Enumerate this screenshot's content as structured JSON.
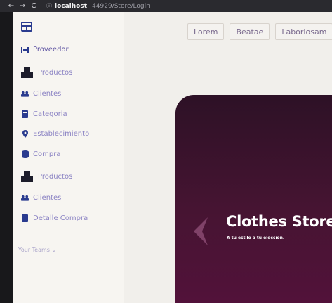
{
  "browser": {
    "nav": {
      "back": "←",
      "forward": "→",
      "reload": "C"
    },
    "url": {
      "host": "localhost",
      "path": ":44929/Store/Login"
    }
  },
  "sidebar": {
    "items": [
      {
        "label": "Proveedor",
        "icon": "people-carry-icon"
      },
      {
        "label": "Productos",
        "icon": "boxes-icon"
      },
      {
        "label": "Clientes",
        "icon": "users-icon"
      },
      {
        "label": "Categoria",
        "icon": "file-list-icon"
      },
      {
        "label": "Establecimiento",
        "icon": "map-pin-icon"
      },
      {
        "label": "Compra",
        "icon": "database-icon"
      },
      {
        "label": "Productos",
        "icon": "boxes-icon"
      },
      {
        "label": "Clientes",
        "icon": "users-icon"
      },
      {
        "label": "Detalle Compra",
        "icon": "file-list-icon"
      }
    ],
    "teams": "Your Teams ⌄"
  },
  "tabs": [
    "Lorem",
    "Beatae",
    "Laboriosam"
  ],
  "hero": {
    "title": "Clothes Store",
    "subtitle": "A tu estilo a tu elección."
  },
  "colors": {
    "accent": "#2a3b8f",
    "menu_text": "#8c84c4",
    "hero_dark": "#2d1126",
    "hero_mid": "#52123a"
  }
}
